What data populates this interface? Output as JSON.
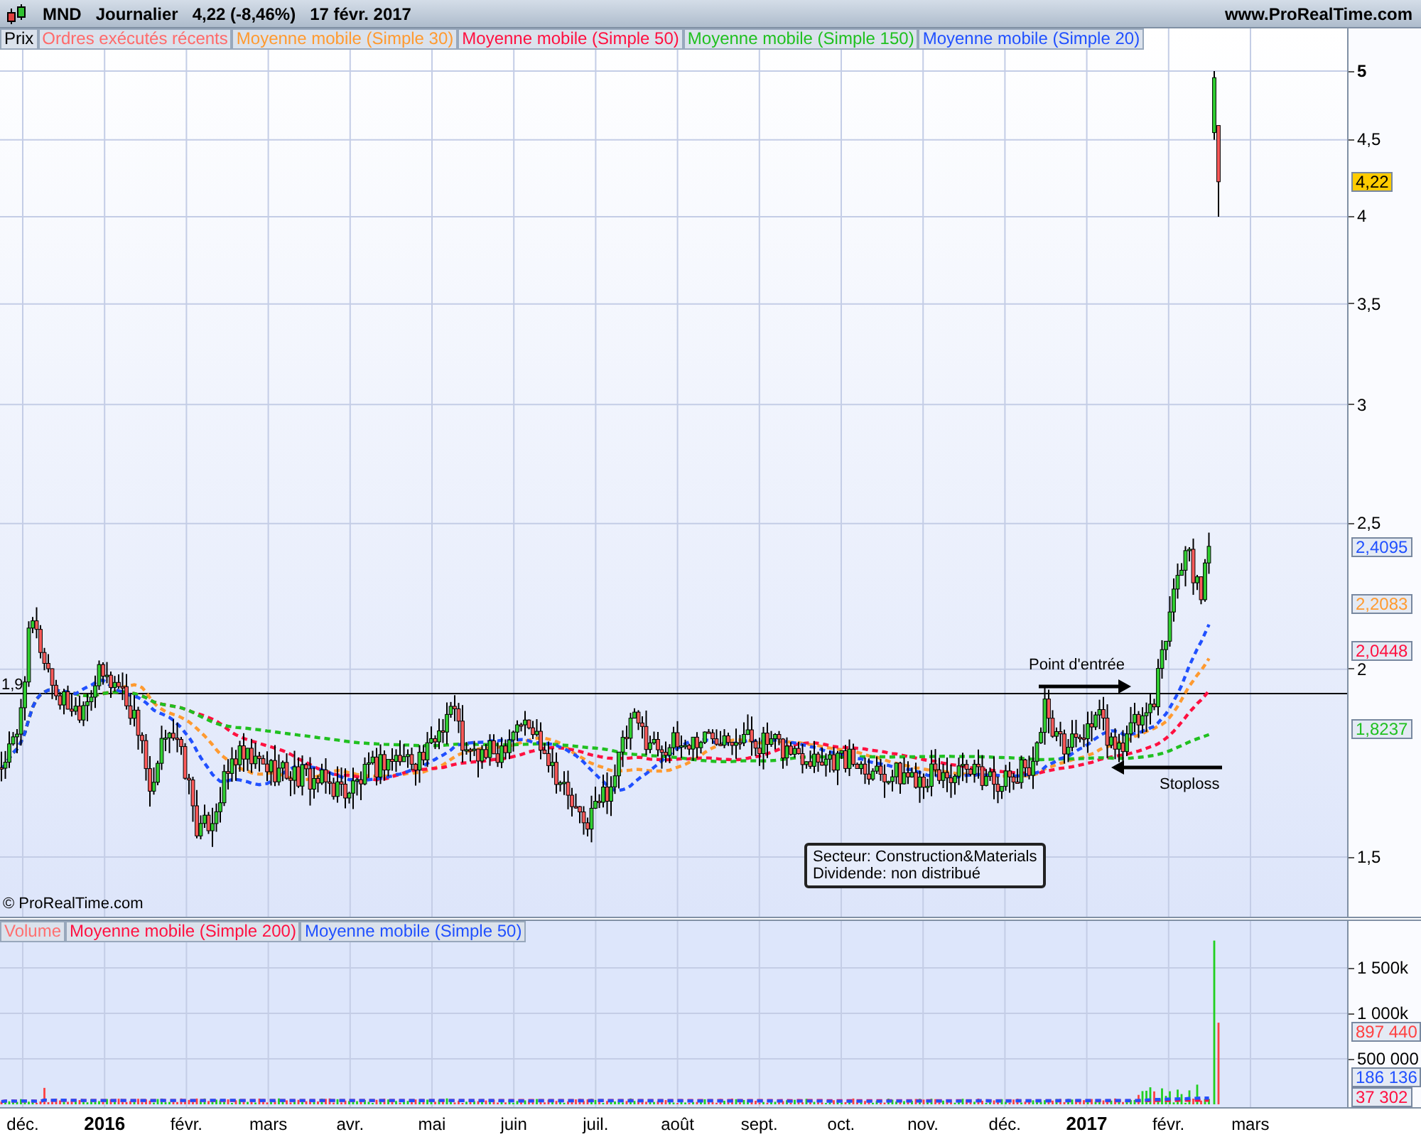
{
  "header": {
    "symbol": "MND",
    "period": "Journalier",
    "quote": "4,22 (-8,46%)",
    "date": "17 févr. 2017",
    "site": "www.ProRealTime.com"
  },
  "price_panel": {
    "legend": [
      {
        "label": "Prix",
        "kind": "price",
        "color": "#000000"
      },
      {
        "label": "Ordres exécutés récents",
        "kind": "orders",
        "color": "#ff6a6a"
      },
      {
        "label": "Moyenne mobile (Simple 30)",
        "kind": "ma",
        "color": "#ff9a30"
      },
      {
        "label": "Moyenne mobile (Simple 50)",
        "kind": "ma",
        "color": "#ff1040"
      },
      {
        "label": "Moyenne mobile (Simple 150)",
        "kind": "ma",
        "color": "#20c020"
      },
      {
        "label": "Moyenne mobile (Simple 20)",
        "kind": "ma",
        "color": "#2050ff"
      }
    ],
    "yticks": [
      {
        "label": "5",
        "kind": "major"
      },
      {
        "label": "4,5",
        "kind": "minor"
      },
      {
        "label": "4",
        "kind": "minor"
      },
      {
        "label": "3,5",
        "kind": "minor"
      },
      {
        "label": "3",
        "kind": "minor"
      },
      {
        "label": "2,5",
        "kind": "minor"
      },
      {
        "label": "2",
        "kind": "minor"
      },
      {
        "label": "1,5",
        "kind": "minor"
      }
    ],
    "level_line": {
      "label": "1,9"
    },
    "badges": [
      {
        "text": "4,22",
        "kind": "current",
        "color": "#ffcc00"
      },
      {
        "text": "2,4095",
        "kind": "indicator",
        "color": "#2050ff"
      },
      {
        "text": "2,2083",
        "kind": "indicator",
        "color": "#ff9a30"
      },
      {
        "text": "2,0448",
        "kind": "indicator",
        "color": "#ff1040"
      },
      {
        "text": "1,8237",
        "kind": "indicator",
        "color": "#20c020"
      }
    ],
    "annotations": [
      {
        "text": "Point d'entrée",
        "kind": "right-arrow"
      },
      {
        "text": "Stoploss",
        "kind": "left-arrow"
      }
    ],
    "info_box": {
      "lines": [
        "Secteur: Construction&Materials",
        "Dividende: non distribué"
      ]
    },
    "copyright": "© ProRealTime.com"
  },
  "volume_panel": {
    "legend": [
      {
        "label": "Volume",
        "kind": "volume",
        "color": "#ff7070"
      },
      {
        "label": "Moyenne mobile (Simple 200)",
        "kind": "ma",
        "color": "#ff1040"
      },
      {
        "label": "Moyenne mobile (Simple 50)",
        "kind": "ma",
        "color": "#2050ff"
      }
    ],
    "yticks": [
      {
        "label": "1 500k"
      },
      {
        "label": "1 000k"
      },
      {
        "label": "500 000"
      }
    ],
    "badges": [
      {
        "text": "897 440",
        "kind": "indicator",
        "color": "#ff4040"
      },
      {
        "text": "186 136",
        "kind": "indicator",
        "color": "#2050ff"
      },
      {
        "text": "37 302",
        "kind": "indicator",
        "color": "#ff1040"
      }
    ]
  },
  "x_axis": [
    {
      "label": "déc.",
      "kind": "month"
    },
    {
      "label": "2016",
      "kind": "year"
    },
    {
      "label": "févr.",
      "kind": "month"
    },
    {
      "label": "mars",
      "kind": "month"
    },
    {
      "label": "avr.",
      "kind": "month"
    },
    {
      "label": "mai",
      "kind": "month"
    },
    {
      "label": "juin",
      "kind": "month"
    },
    {
      "label": "juil.",
      "kind": "month"
    },
    {
      "label": "août",
      "kind": "month"
    },
    {
      "label": "sept.",
      "kind": "month"
    },
    {
      "label": "oct.",
      "kind": "month"
    },
    {
      "label": "nov.",
      "kind": "month"
    },
    {
      "label": "déc.",
      "kind": "month"
    },
    {
      "label": "2017",
      "kind": "year"
    },
    {
      "label": "févr.",
      "kind": "month"
    },
    {
      "label": "mars",
      "kind": "month"
    }
  ]
}
